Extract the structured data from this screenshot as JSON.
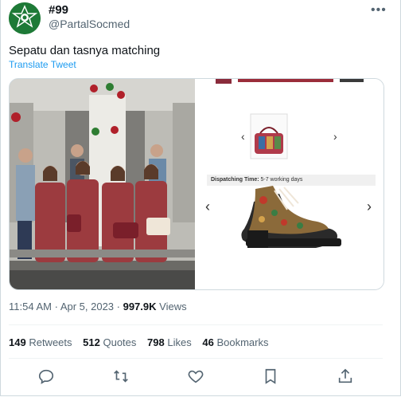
{
  "tweet": {
    "display_name": "#99",
    "handle": "@PartalSocmed",
    "text": "Sepatu dan tasnya matching",
    "translate_label": "Translate Tweet",
    "time": "11:54 AM",
    "separator": " · ",
    "date": "Apr 5, 2023",
    "views_count": "997.9K",
    "views_label": "Views"
  },
  "stats": [
    {
      "count": "149",
      "label": "Retweets"
    },
    {
      "count": "512",
      "label": "Quotes"
    },
    {
      "count": "798",
      "label": "Likes"
    },
    {
      "count": "46",
      "label": "Bookmarks"
    }
  ],
  "media": {
    "dispatch_label": "Dispatching Time:",
    "dispatch_value": "5-7 working days"
  },
  "colors": {
    "accent": "#1d9bf0",
    "avatar_bg": "#1e7a37",
    "muted": "#536471"
  },
  "actions": [
    "reply-icon",
    "retweet-icon",
    "like-icon",
    "bookmark-icon",
    "share-icon"
  ]
}
